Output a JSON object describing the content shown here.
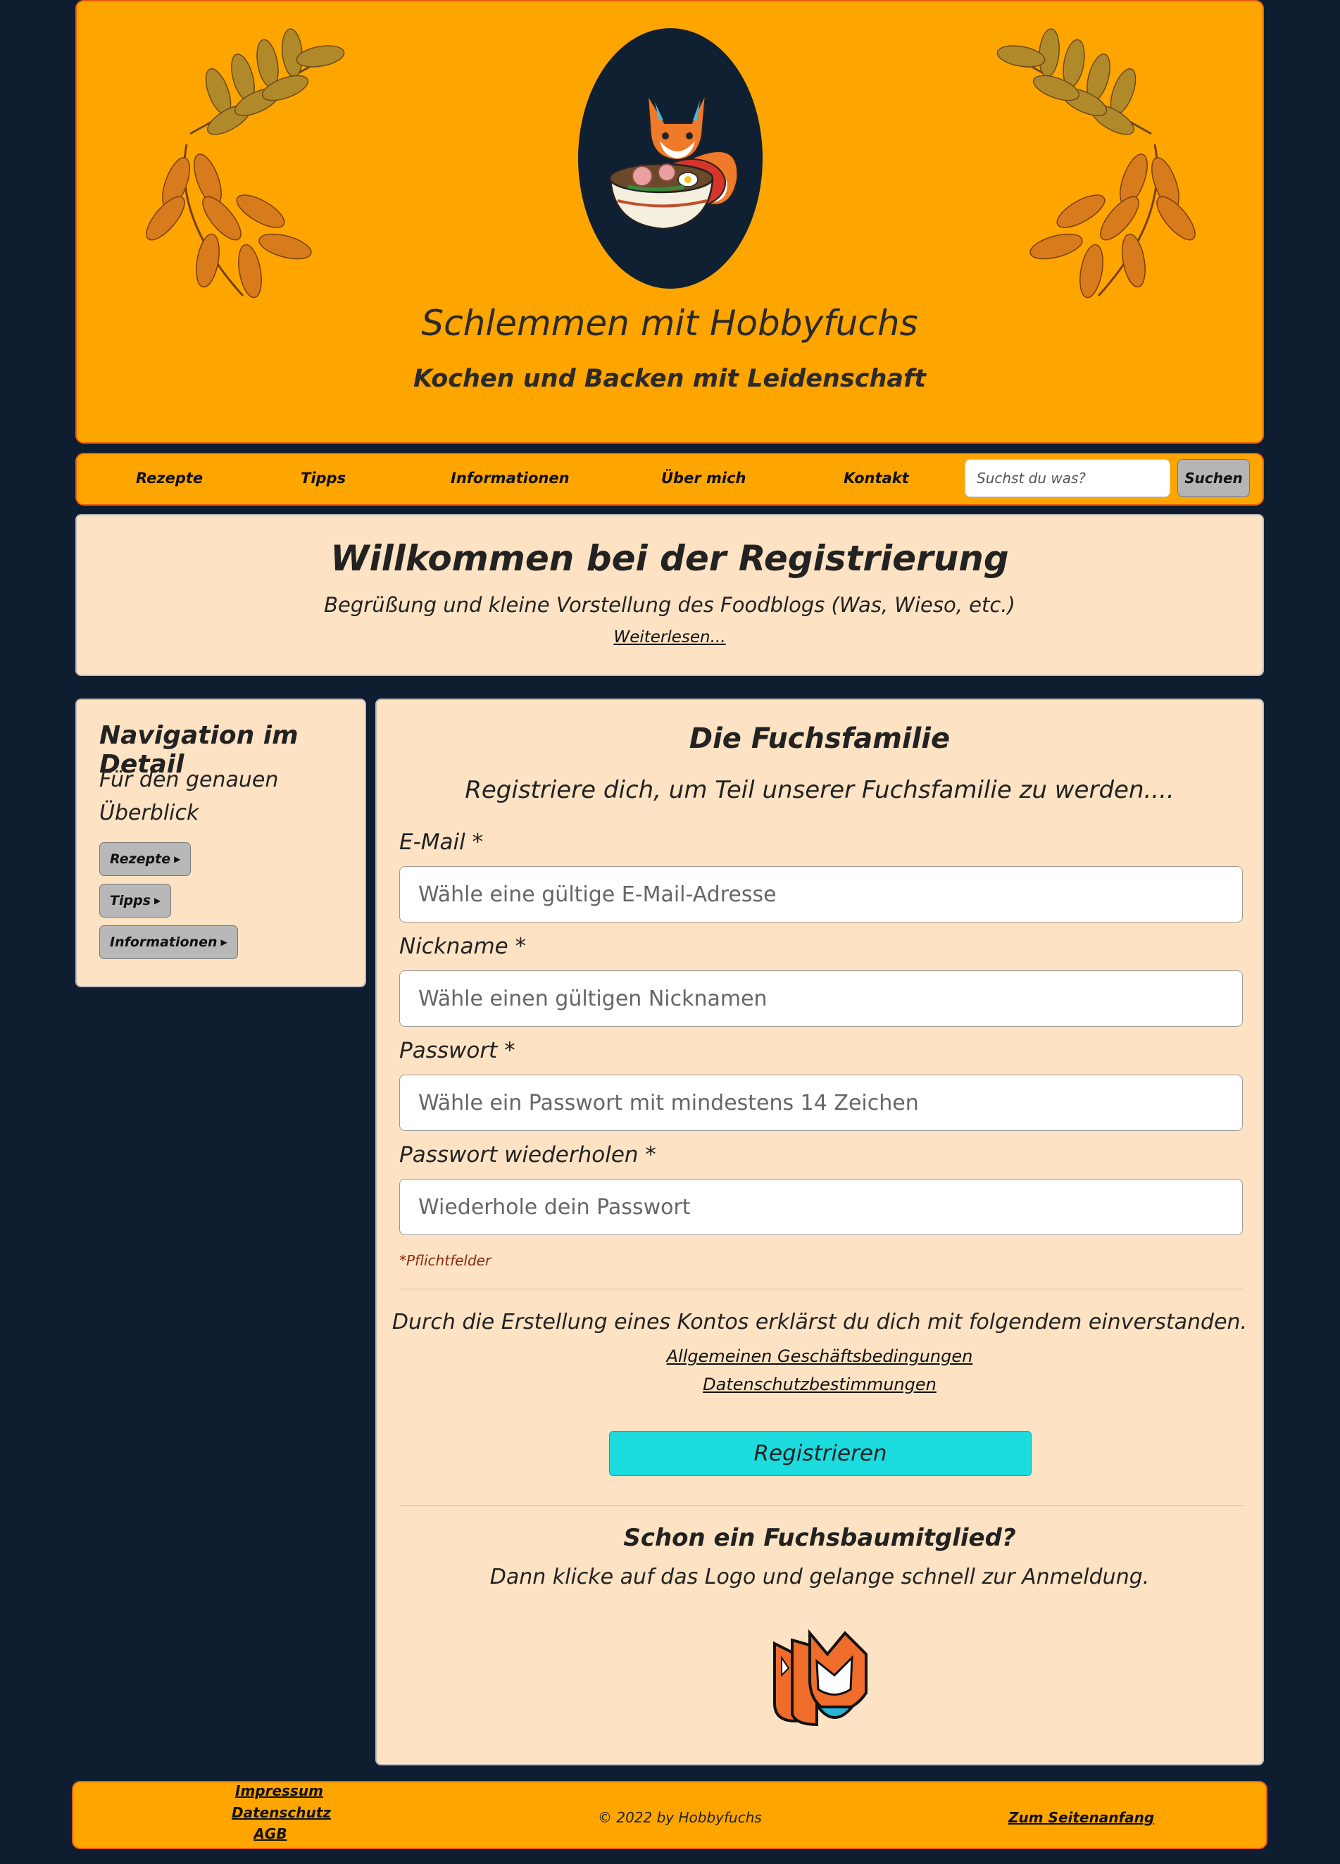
{
  "header": {
    "title": "Schlemmen mit Hobbyfuchs",
    "subtitle": "Kochen und Backen mit Leidenschaft"
  },
  "nav": {
    "items": [
      "Rezepte",
      "Tipps",
      "Informationen",
      "Über mich",
      "Kontakt"
    ],
    "search_placeholder": "Suchst du was?",
    "search_button": "Suchen"
  },
  "welcome": {
    "title": "Willkommen bei der Registrierung",
    "text": "Begrüßung und kleine Vorstellung des Foodblogs (Was, Wieso, etc.)",
    "link": "Weiterlesen..."
  },
  "sidebar": {
    "title": "Navigation im Detail",
    "subtitle": "Für den genauen Überblick",
    "buttons": [
      "Rezepte",
      "Tipps",
      "Informationen"
    ]
  },
  "form": {
    "title": "Die Fuchsfamilie",
    "intro": "Registriere dich, um Teil unserer Fuchsfamilie zu werden....",
    "fields": [
      {
        "label": "E-Mail *",
        "placeholder": "Wähle eine gültige E-Mail-Adresse"
      },
      {
        "label": "Nickname *",
        "placeholder": "Wähle einen gültigen Nicknamen"
      },
      {
        "label": "Passwort *",
        "placeholder": "Wähle ein Passwort mit mindestens 14 Zeichen"
      },
      {
        "label": "Passwort wiederholen *",
        "placeholder": "Wiederhole dein Passwort"
      }
    ],
    "required_note": "*Pflichtfelder",
    "consent_text": "Durch die Erstellung eines Kontos erklärst du dich mit folgendem einverstanden.",
    "agb_link": "Allgemeinen Geschäftsbedingungen",
    "privacy_link": "Datenschutzbestimmungen",
    "register_button": "Registrieren",
    "member_title": "Schon ein Fuchsbaumitglied?",
    "member_text": "Dann klicke auf das Logo und gelange schnell zur Anmeldung."
  },
  "footer": {
    "links": [
      "Impressum",
      "Datenschutz",
      "AGB"
    ],
    "copyright": "© 2022 by Hobbyfuchs",
    "top_link": "Zum Seitenanfang"
  },
  "colors": {
    "background": "#0e1e30",
    "header": "#ffa500",
    "card": "#fde3c3",
    "register_button": "#1ddce0",
    "required_note": "#8b2a0e"
  },
  "icons": {
    "header_logo": "fox-ramen-logo-icon",
    "leaves": "autumn-leaf-icon",
    "login_logo": "fox-login-logo-icon"
  }
}
